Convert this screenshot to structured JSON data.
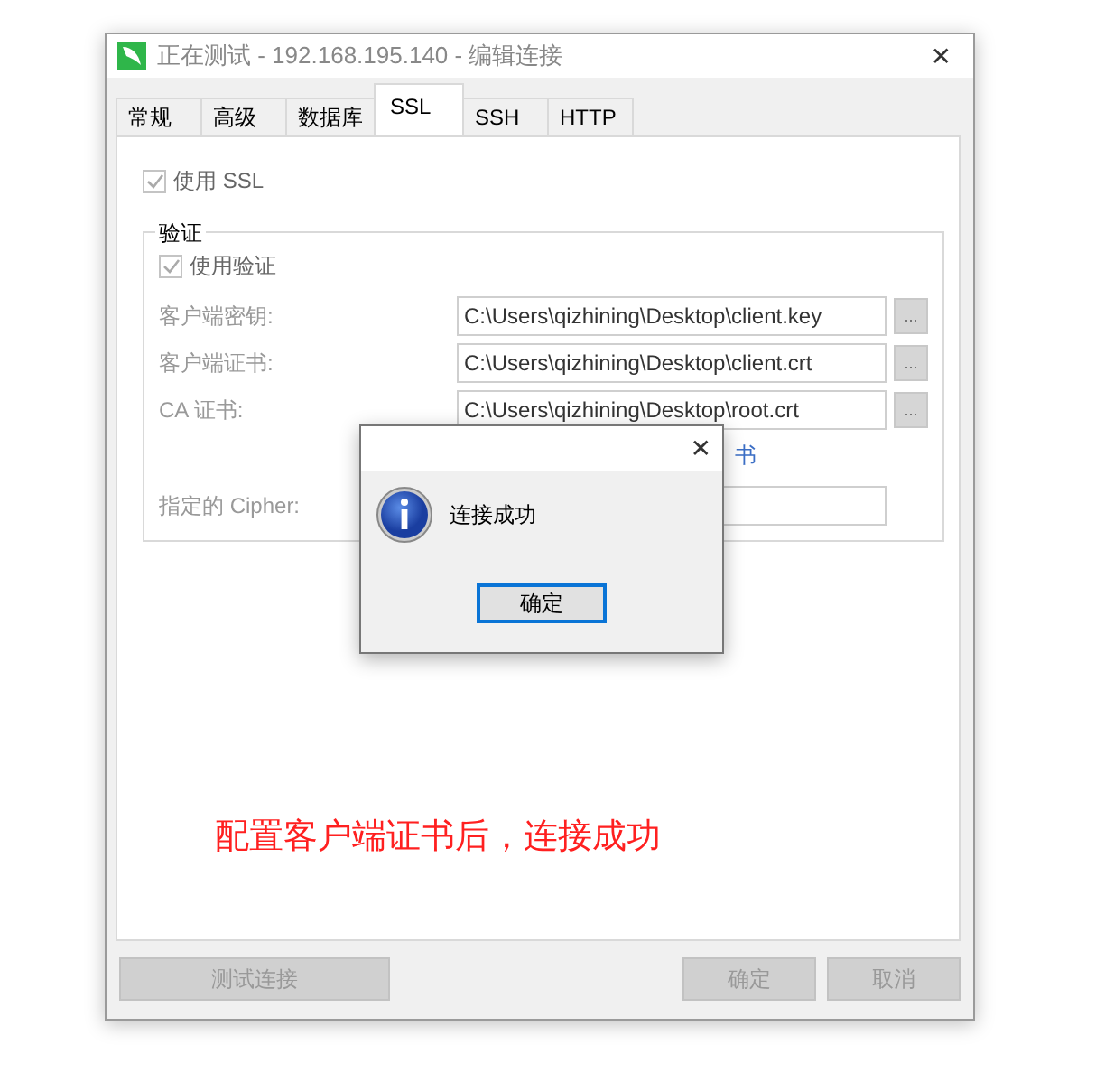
{
  "window": {
    "title": "正在测试 - 192.168.195.140 - 编辑连接",
    "close": "✕"
  },
  "tabs": [
    {
      "label": "常规",
      "selected": false
    },
    {
      "label": "高级",
      "selected": false
    },
    {
      "label": "数据库",
      "selected": false
    },
    {
      "label": "SSL",
      "selected": true
    },
    {
      "label": "SSH",
      "selected": false
    },
    {
      "label": "HTTP",
      "selected": false
    }
  ],
  "use_ssl": {
    "label": "使用 SSL",
    "checked": true
  },
  "auth_group": {
    "title": "验证",
    "use_auth": {
      "label": "使用验证",
      "checked": true
    },
    "fields": [
      {
        "label": "客户端密钥:",
        "value": "C:\\Users\\qizhining\\Desktop\\client.key",
        "browse": "..."
      },
      {
        "label": "客户端证书:",
        "value": "C:\\Users\\qizhining\\Desktop\\client.crt",
        "browse": "..."
      },
      {
        "label": "CA 证书:",
        "value": "C:\\Users\\qizhining\\Desktop\\root.crt",
        "browse": "..."
      }
    ],
    "partial_label": "书",
    "cipher": {
      "label": "指定的 Cipher:"
    }
  },
  "annotation": "配置客户端证书后，连接成功",
  "footer_buttons": [
    {
      "label": "测试连接",
      "disabled": true
    },
    {
      "label": "确定",
      "disabled": true
    },
    {
      "label": "取消",
      "disabled": true
    }
  ],
  "message_box": {
    "close": "✕",
    "text": "连接成功",
    "button": "确定"
  }
}
